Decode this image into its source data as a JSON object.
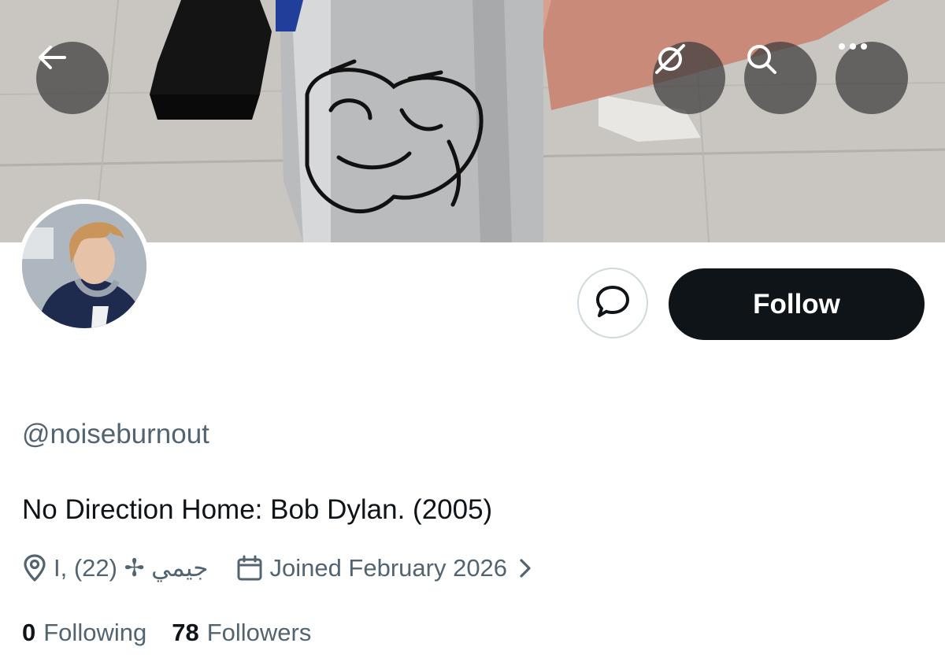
{
  "header": {
    "back_icon": "arrow-left-icon",
    "grok_icon": "grok-icon",
    "search_icon": "search-icon",
    "more_icon": "more-horizontal-icon"
  },
  "banner": {
    "description_icon": "banner-photo"
  },
  "profile": {
    "handle": "@noiseburnout",
    "bio": "No Direction Home: Bob Dylan. (2005)",
    "location": "I, (22) ✢ جيمي",
    "joined": "Joined February 2026",
    "following_count": "0",
    "following_label": "Following",
    "followers_count": "78",
    "followers_label": "Followers"
  },
  "actions": {
    "message_icon": "message-bubble-icon",
    "follow_label": "Follow"
  },
  "colors": {
    "primary_text": "#0f1419",
    "secondary_text": "#536471",
    "follow_bg": "#0f1419",
    "follow_text": "#ffffff",
    "border": "#cfd9de"
  }
}
